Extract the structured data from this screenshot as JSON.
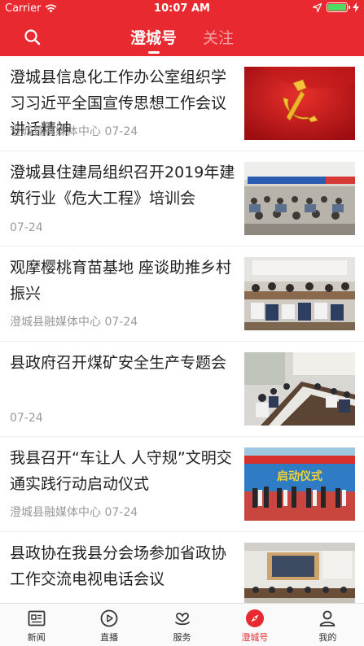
{
  "status_bar": {
    "carrier": "Carrier",
    "time": "10:07 AM",
    "battery_level": 1.0
  },
  "header": {
    "tabs": [
      {
        "label": "澄城号",
        "active": true
      },
      {
        "label": "关注",
        "active": false
      }
    ],
    "accent_color": "#e8292f"
  },
  "feed": [
    {
      "title": "澄城县信息化工作办公室组织学习习近平全国宣传思想工作会议讲话精神",
      "source": "澄城县融媒体中心",
      "date": "07-24",
      "thumb": "party-emblem-image"
    },
    {
      "title": "澄城县住建局组织召开2019年建筑行业《危大工程》培训会",
      "source": "",
      "date": "07-24",
      "thumb": "training-meeting-photo"
    },
    {
      "title": "观摩樱桃育苗基地 座谈助推乡村振兴",
      "source": "澄城县融媒体中心",
      "date": "07-24",
      "thumb": "seminar-photo"
    },
    {
      "title": "县政府召开煤矿安全生产专题会",
      "source": "",
      "date": "07-24",
      "thumb": "conference-table-photo"
    },
    {
      "title": "我县召开“车让人 人守规”文明交通实践行动启动仪式",
      "source": "澄城县融媒体中心",
      "date": "07-24",
      "thumb": "launch-ceremony-photo"
    },
    {
      "title": "县政协在我县分会场参加省政协工作交流电视电话会议",
      "source": "",
      "date": "",
      "thumb": "video-conference-photo"
    }
  ],
  "ceremony_banner_text": "启动仪式",
  "tabbar": [
    {
      "label": "新闻",
      "icon": "news-icon",
      "active": false
    },
    {
      "label": "直播",
      "icon": "play-icon",
      "active": false
    },
    {
      "label": "服务",
      "icon": "service-icon",
      "active": false
    },
    {
      "label": "澄城号",
      "icon": "compass-icon",
      "active": true
    },
    {
      "label": "我的",
      "icon": "person-icon",
      "active": false
    }
  ]
}
